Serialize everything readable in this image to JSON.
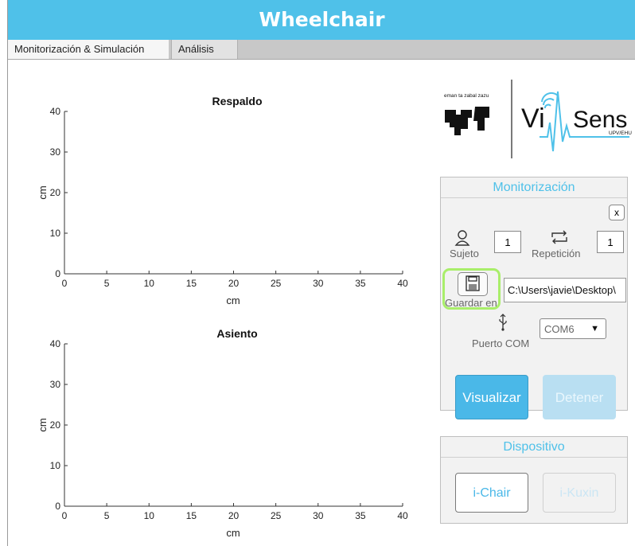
{
  "app": {
    "title": "Wheelchair"
  },
  "tabs": [
    {
      "label": "Monitorización & Simulación",
      "active": true
    },
    {
      "label": "Análisis",
      "active": false
    }
  ],
  "plots": {
    "respaldo": {
      "title": "Respaldo",
      "xlabel": "cm",
      "ylabel": "cm",
      "xticks": [
        "0",
        "5",
        "10",
        "15",
        "20",
        "25",
        "30",
        "35",
        "40"
      ],
      "yticks": [
        "0",
        "10",
        "20",
        "30",
        "40"
      ]
    },
    "asiento": {
      "title": "Asiento",
      "xlabel": "cm",
      "ylabel": "cm",
      "xticks": [
        "0",
        "5",
        "10",
        "15",
        "20",
        "25",
        "30",
        "35",
        "40"
      ],
      "yticks": [
        "0",
        "10",
        "20",
        "30",
        "40"
      ]
    }
  },
  "chart_data": [
    {
      "type": "scatter",
      "title": "Respaldo",
      "xlabel": "cm",
      "ylabel": "cm",
      "xlim": [
        0,
        40
      ],
      "ylim": [
        0,
        40
      ],
      "series": []
    },
    {
      "type": "scatter",
      "title": "Asiento",
      "xlabel": "cm",
      "ylabel": "cm",
      "xlim": [
        0,
        40
      ],
      "ylim": [
        0,
        40
      ],
      "series": []
    }
  ],
  "logo": {
    "tagline": "eman ta zabal zazu",
    "brand_vi": "Vi",
    "brand_sens": "Sens",
    "brand_sub": "UPV/EHU"
  },
  "monitor": {
    "title": "Monitorización",
    "close_label": "x",
    "subject_label": "Sujeto",
    "subject_value": "1",
    "repetition_label": "Repetición",
    "repetition_value": "1",
    "save_label": "Guardar en",
    "save_path": "C:\\Users\\javie\\Desktop\\",
    "port_label": "Puerto COM",
    "port_value": "COM6",
    "start_label": "Visualizar",
    "stop_label": "Detener",
    "icons": [
      "user-icon",
      "repeat-icon",
      "floppy-disk-icon",
      "usb-icon",
      "dropdown-arrow-icon"
    ]
  },
  "device": {
    "title": "Dispositivo",
    "btn1": "i-Chair",
    "btn2": "i-Kuxin"
  },
  "colors": {
    "accent": "#4fc1e9",
    "highlight": "#a9ee6a",
    "tabbar": "#c8c8c8"
  }
}
